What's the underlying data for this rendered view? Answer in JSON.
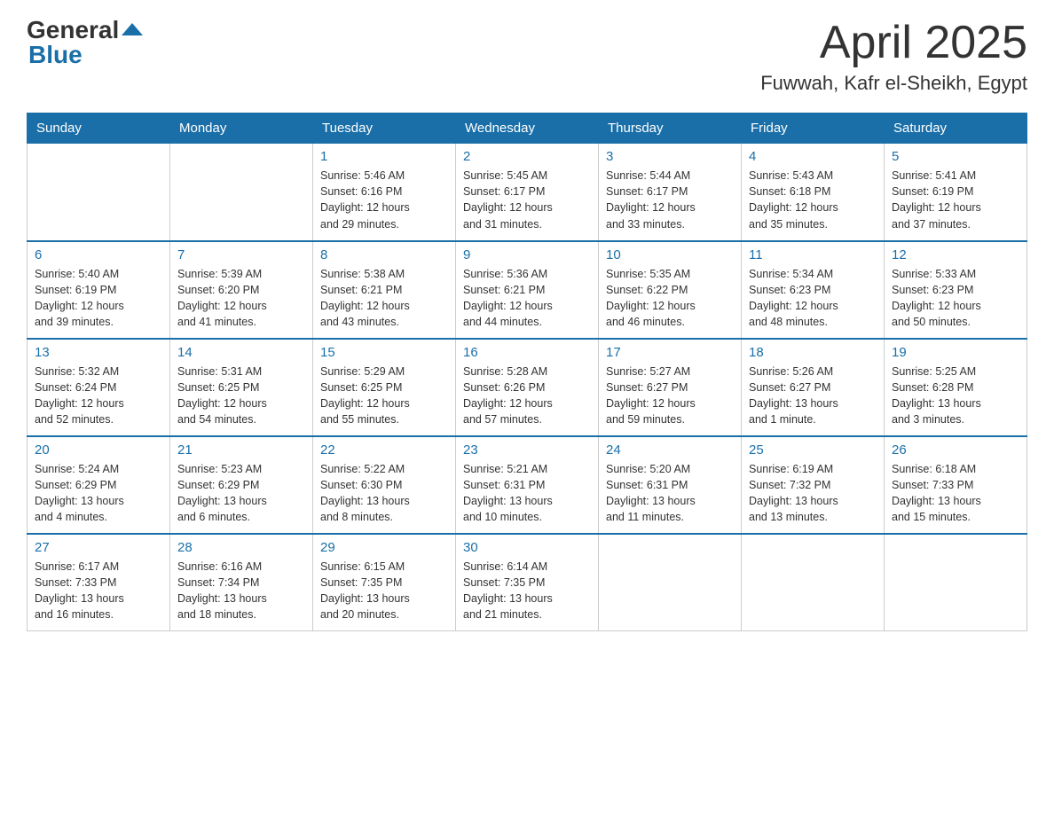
{
  "header": {
    "logo_general": "General",
    "logo_blue": "Blue",
    "title": "April 2025",
    "subtitle": "Fuwwah, Kafr el-Sheikh, Egypt"
  },
  "days_of_week": [
    "Sunday",
    "Monday",
    "Tuesday",
    "Wednesday",
    "Thursday",
    "Friday",
    "Saturday"
  ],
  "weeks": [
    [
      {
        "day": "",
        "info": ""
      },
      {
        "day": "",
        "info": ""
      },
      {
        "day": "1",
        "info": "Sunrise: 5:46 AM\nSunset: 6:16 PM\nDaylight: 12 hours\nand 29 minutes."
      },
      {
        "day": "2",
        "info": "Sunrise: 5:45 AM\nSunset: 6:17 PM\nDaylight: 12 hours\nand 31 minutes."
      },
      {
        "day": "3",
        "info": "Sunrise: 5:44 AM\nSunset: 6:17 PM\nDaylight: 12 hours\nand 33 minutes."
      },
      {
        "day": "4",
        "info": "Sunrise: 5:43 AM\nSunset: 6:18 PM\nDaylight: 12 hours\nand 35 minutes."
      },
      {
        "day": "5",
        "info": "Sunrise: 5:41 AM\nSunset: 6:19 PM\nDaylight: 12 hours\nand 37 minutes."
      }
    ],
    [
      {
        "day": "6",
        "info": "Sunrise: 5:40 AM\nSunset: 6:19 PM\nDaylight: 12 hours\nand 39 minutes."
      },
      {
        "day": "7",
        "info": "Sunrise: 5:39 AM\nSunset: 6:20 PM\nDaylight: 12 hours\nand 41 minutes."
      },
      {
        "day": "8",
        "info": "Sunrise: 5:38 AM\nSunset: 6:21 PM\nDaylight: 12 hours\nand 43 minutes."
      },
      {
        "day": "9",
        "info": "Sunrise: 5:36 AM\nSunset: 6:21 PM\nDaylight: 12 hours\nand 44 minutes."
      },
      {
        "day": "10",
        "info": "Sunrise: 5:35 AM\nSunset: 6:22 PM\nDaylight: 12 hours\nand 46 minutes."
      },
      {
        "day": "11",
        "info": "Sunrise: 5:34 AM\nSunset: 6:23 PM\nDaylight: 12 hours\nand 48 minutes."
      },
      {
        "day": "12",
        "info": "Sunrise: 5:33 AM\nSunset: 6:23 PM\nDaylight: 12 hours\nand 50 minutes."
      }
    ],
    [
      {
        "day": "13",
        "info": "Sunrise: 5:32 AM\nSunset: 6:24 PM\nDaylight: 12 hours\nand 52 minutes."
      },
      {
        "day": "14",
        "info": "Sunrise: 5:31 AM\nSunset: 6:25 PM\nDaylight: 12 hours\nand 54 minutes."
      },
      {
        "day": "15",
        "info": "Sunrise: 5:29 AM\nSunset: 6:25 PM\nDaylight: 12 hours\nand 55 minutes."
      },
      {
        "day": "16",
        "info": "Sunrise: 5:28 AM\nSunset: 6:26 PM\nDaylight: 12 hours\nand 57 minutes."
      },
      {
        "day": "17",
        "info": "Sunrise: 5:27 AM\nSunset: 6:27 PM\nDaylight: 12 hours\nand 59 minutes."
      },
      {
        "day": "18",
        "info": "Sunrise: 5:26 AM\nSunset: 6:27 PM\nDaylight: 13 hours\nand 1 minute."
      },
      {
        "day": "19",
        "info": "Sunrise: 5:25 AM\nSunset: 6:28 PM\nDaylight: 13 hours\nand 3 minutes."
      }
    ],
    [
      {
        "day": "20",
        "info": "Sunrise: 5:24 AM\nSunset: 6:29 PM\nDaylight: 13 hours\nand 4 minutes."
      },
      {
        "day": "21",
        "info": "Sunrise: 5:23 AM\nSunset: 6:29 PM\nDaylight: 13 hours\nand 6 minutes."
      },
      {
        "day": "22",
        "info": "Sunrise: 5:22 AM\nSunset: 6:30 PM\nDaylight: 13 hours\nand 8 minutes."
      },
      {
        "day": "23",
        "info": "Sunrise: 5:21 AM\nSunset: 6:31 PM\nDaylight: 13 hours\nand 10 minutes."
      },
      {
        "day": "24",
        "info": "Sunrise: 5:20 AM\nSunset: 6:31 PM\nDaylight: 13 hours\nand 11 minutes."
      },
      {
        "day": "25",
        "info": "Sunrise: 6:19 AM\nSunset: 7:32 PM\nDaylight: 13 hours\nand 13 minutes."
      },
      {
        "day": "26",
        "info": "Sunrise: 6:18 AM\nSunset: 7:33 PM\nDaylight: 13 hours\nand 15 minutes."
      }
    ],
    [
      {
        "day": "27",
        "info": "Sunrise: 6:17 AM\nSunset: 7:33 PM\nDaylight: 13 hours\nand 16 minutes."
      },
      {
        "day": "28",
        "info": "Sunrise: 6:16 AM\nSunset: 7:34 PM\nDaylight: 13 hours\nand 18 minutes."
      },
      {
        "day": "29",
        "info": "Sunrise: 6:15 AM\nSunset: 7:35 PM\nDaylight: 13 hours\nand 20 minutes."
      },
      {
        "day": "30",
        "info": "Sunrise: 6:14 AM\nSunset: 7:35 PM\nDaylight: 13 hours\nand 21 minutes."
      },
      {
        "day": "",
        "info": ""
      },
      {
        "day": "",
        "info": ""
      },
      {
        "day": "",
        "info": ""
      }
    ]
  ]
}
